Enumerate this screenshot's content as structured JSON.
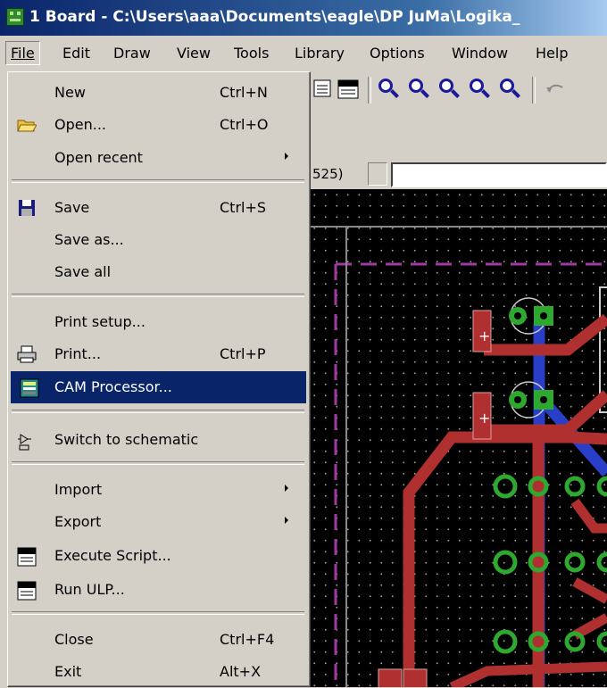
{
  "window": {
    "title": "1 Board - C:\\Users\\aaa\\Documents\\eagle\\DP JuMa\\Logika_"
  },
  "menubar": {
    "items": [
      {
        "label": "File",
        "key": "F"
      },
      {
        "label": "Edit",
        "key": "E"
      },
      {
        "label": "Draw",
        "key": "D"
      },
      {
        "label": "View",
        "key": "V"
      },
      {
        "label": "Tools",
        "key": "T"
      },
      {
        "label": "Library",
        "key": "L"
      },
      {
        "label": "Options",
        "key": "O"
      },
      {
        "label": "Window",
        "key": "W"
      },
      {
        "label": "Help",
        "key": "H"
      }
    ]
  },
  "file_menu": {
    "items": [
      {
        "label": "New",
        "shortcut": "Ctrl+N"
      },
      {
        "label": "Open...",
        "shortcut": "Ctrl+O",
        "icon": "folder-open-icon"
      },
      {
        "label": "Open recent",
        "shortcut": ""
      },
      {
        "label": "Save",
        "shortcut": "Ctrl+S",
        "icon": "floppy-disk-icon"
      },
      {
        "label": "Save as...",
        "shortcut": ""
      },
      {
        "label": "Save all",
        "shortcut": ""
      },
      {
        "label": "Print setup...",
        "shortcut": ""
      },
      {
        "label": "Print...",
        "shortcut": "Ctrl+P",
        "icon": "printer-icon"
      },
      {
        "label": "CAM Processor...",
        "shortcut": "",
        "icon": "cam-processor-icon"
      },
      {
        "label": "Switch to schematic",
        "shortcut": "",
        "icon": "schematic-switch-icon"
      },
      {
        "label": "Import",
        "shortcut": ""
      },
      {
        "label": "Export",
        "shortcut": ""
      },
      {
        "label": "Execute Script...",
        "shortcut": "",
        "icon": "script-scr-icon"
      },
      {
        "label": "Run ULP...",
        "shortcut": "",
        "icon": "ulp-icon"
      },
      {
        "label": "Close",
        "shortcut": "Ctrl+F4"
      },
      {
        "label": "Exit",
        "shortcut": "Alt+X"
      }
    ],
    "highlighted": "CAM Processor..."
  },
  "toolbar": {
    "icons": [
      "script-icon",
      "ulp-icon",
      "zoom-fit-icon",
      "zoom-in-icon",
      "zoom-out-icon",
      "zoom-redraw-icon",
      "zoom-select-icon",
      "undo-icon"
    ]
  },
  "status": {
    "coordinate": "525)",
    "command_input": ""
  },
  "colors": {
    "title_bar": "#0a246a",
    "menu_highlight": "#0a246a",
    "canvas_bg": "#000000",
    "top_layer": "#b03030",
    "bottom_layer": "#2a3fc8",
    "pads": "#2ea82e",
    "dimension": "#a03aa0"
  }
}
